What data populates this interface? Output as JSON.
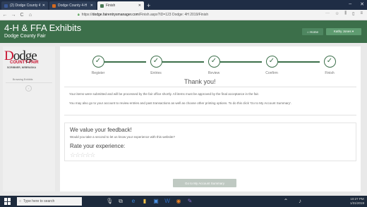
{
  "browser": {
    "tabs": [
      {
        "label": "(2) Dodge County 4-H (Nebras",
        "fav": "#3b5998"
      },
      {
        "label": "Dodge County 4-H Fair | Scr",
        "fav": "#d46a1f"
      },
      {
        "label": "Finish",
        "fav": "#4a7a55"
      }
    ],
    "new_tab_label": "+",
    "url_prefix": "https://",
    "url_domain": "dodge.fairentrysmanager.com",
    "url_rest": "/Finish.aspx?ID=123  Dodge: 4H 2019/Finish",
    "url_more": "···",
    "nav": {
      "back": "←",
      "forward": "→",
      "reload": "C",
      "home": "⌂"
    },
    "window_controls": {
      "minimize": "–",
      "close": "✕"
    }
  },
  "header": {
    "title": "4-H & FFA Exhibits",
    "subtitle": "Dodge County Fair",
    "home_label": "Home",
    "account_label": "Kathy Jones ▾",
    "accent": "#3c6f4a"
  },
  "sidebar": {
    "logo": {
      "word": "odge",
      "initial": "D",
      "fair": "COUNTY FAIR",
      "location": "SCRIBNER, NEBRASKA"
    },
    "link": "Browsing Exhibits"
  },
  "steps": [
    {
      "label": "Register",
      "done": true
    },
    {
      "label": "Entries",
      "done": true
    },
    {
      "label": "Review",
      "done": true
    },
    {
      "label": "Confirm",
      "done": true
    },
    {
      "label": "Finish",
      "done": true
    }
  ],
  "thank_you": "Thank you!",
  "message": {
    "line1": "Your items were submitted and will be processed by the fair office shortly. All items must be approved by the final acceptance in the fair.",
    "line2": "You may also go to your account to review entries and past transactions as well as choose other printing options. To do this click 'Go to My Account Summary'."
  },
  "feedback": {
    "title": "We value your feedback!",
    "question": "Would you take a second to let us know your experience with this website?",
    "rate_label": "Rate your experience:",
    "stars": "☆☆☆☆☆"
  },
  "summary_button": "Go to My Account Summary",
  "taskbar": {
    "search_placeholder": "Type here to search",
    "time": "10:27 PM",
    "date": "1/31/2019"
  }
}
